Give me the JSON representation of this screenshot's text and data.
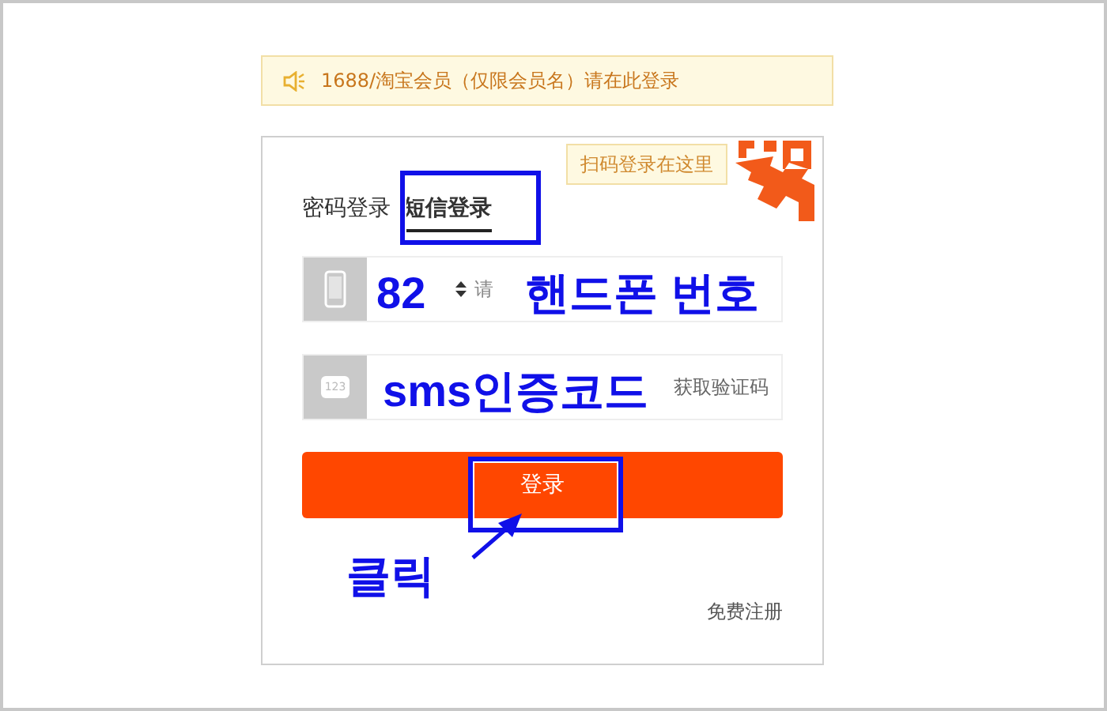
{
  "notice": {
    "text": "1688/淘宝会员（仅限会员名）请在此登录"
  },
  "qr_tip": "扫码登录在这里",
  "tabs": [
    {
      "label": "密码登录",
      "selected": false
    },
    {
      "label": "短信登录",
      "selected": true
    }
  ],
  "phone_field": {
    "placeholder": "请"
  },
  "code_field": {
    "icon_text": "123",
    "button": "获取验证码"
  },
  "login_button": "登录",
  "register_link": "免费注册",
  "annotations": [
    {
      "kind": "label",
      "text": "82"
    },
    {
      "kind": "label",
      "text": "핸드폰 번호"
    },
    {
      "kind": "label",
      "text": "sms인증코드"
    },
    {
      "kind": "box"
    },
    {
      "kind": "box"
    },
    {
      "kind": "arrow"
    },
    {
      "kind": "label",
      "text": "클릭"
    }
  ]
}
